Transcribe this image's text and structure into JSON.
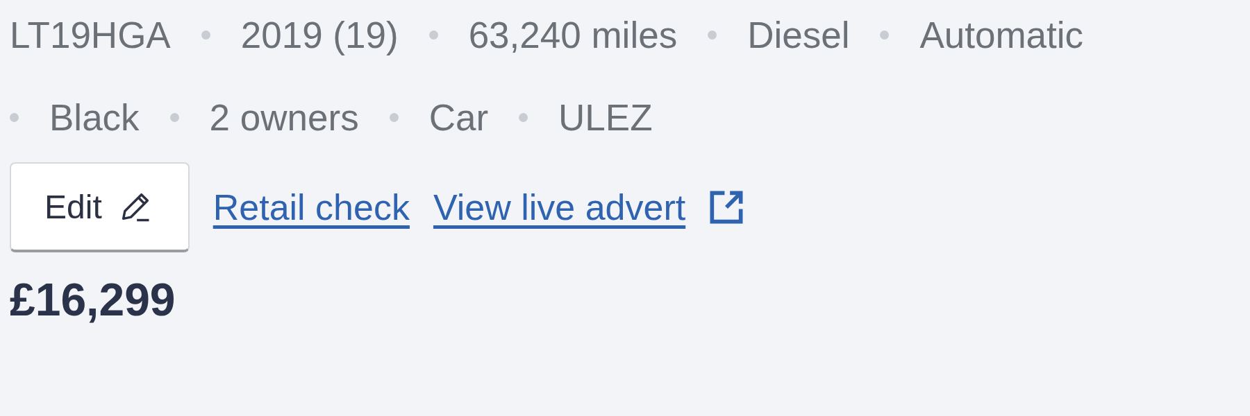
{
  "specs": [
    "LT19HGA",
    "2019 (19)",
    "63,240 miles",
    "Diesel",
    "Automatic",
    "Black",
    "2 owners",
    "Car",
    "ULEZ"
  ],
  "actions": {
    "edit": "Edit",
    "links": [
      {
        "label": "Retail check",
        "external": false
      },
      {
        "label": "View live advert",
        "external": true
      }
    ]
  },
  "price": "£16,299"
}
